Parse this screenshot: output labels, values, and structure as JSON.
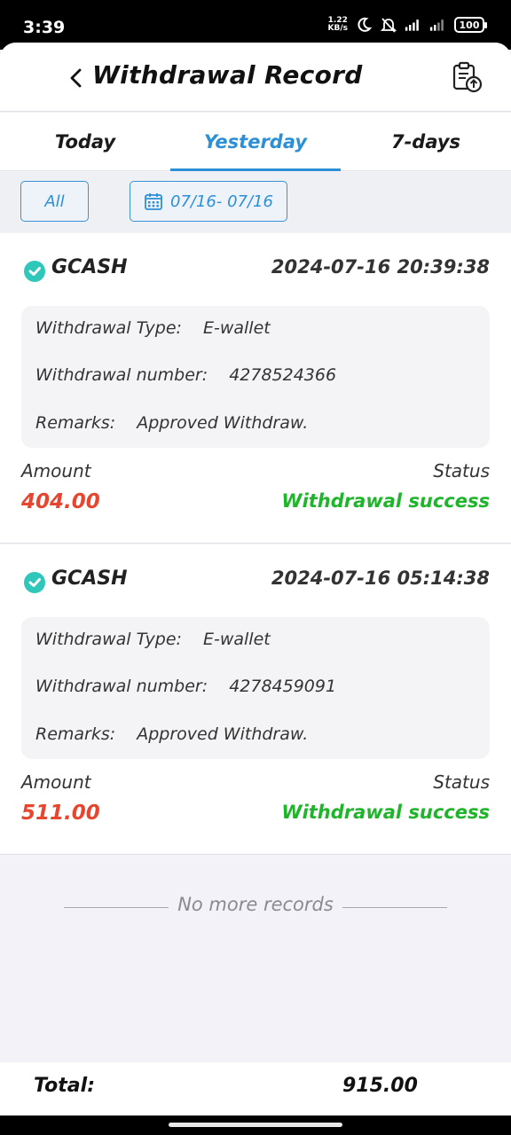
{
  "status_bar": {
    "time": "3:39",
    "net_speed_value": "1.22",
    "net_speed_unit": "KB/s",
    "battery": "100"
  },
  "header": {
    "title": "Withdrawal Record"
  },
  "tabs": [
    {
      "label": "Today",
      "active": false
    },
    {
      "label": "Yesterday",
      "active": true
    },
    {
      "label": "7-days",
      "active": false
    }
  ],
  "filters": {
    "all_label": "All",
    "date_range": "07/16- 07/16"
  },
  "labels": {
    "withdrawal_type": "Withdrawal Type:",
    "withdrawal_number": "Withdrawal number:",
    "remarks": "Remarks:",
    "amount": "Amount",
    "status": "Status"
  },
  "records": [
    {
      "provider": "GCASH",
      "datetime": "2024-07-16 20:39:38",
      "type": "E-wallet",
      "number": "4278524366",
      "remarks": "Approved Withdraw.",
      "amount": "404.00",
      "status": "Withdrawal success"
    },
    {
      "provider": "GCASH",
      "datetime": "2024-07-16 05:14:38",
      "type": "E-wallet",
      "number": "4278459091",
      "remarks": "Approved Withdraw.",
      "amount": "511.00",
      "status": "Withdrawal success"
    }
  ],
  "no_more_text": "No more records",
  "footer": {
    "total_label": "Total:",
    "total_value": "915.00"
  },
  "colors": {
    "accent": "#2d8fd6",
    "amount": "#e8452f",
    "success": "#1fb52b",
    "gcash": "#2ec7b9"
  }
}
